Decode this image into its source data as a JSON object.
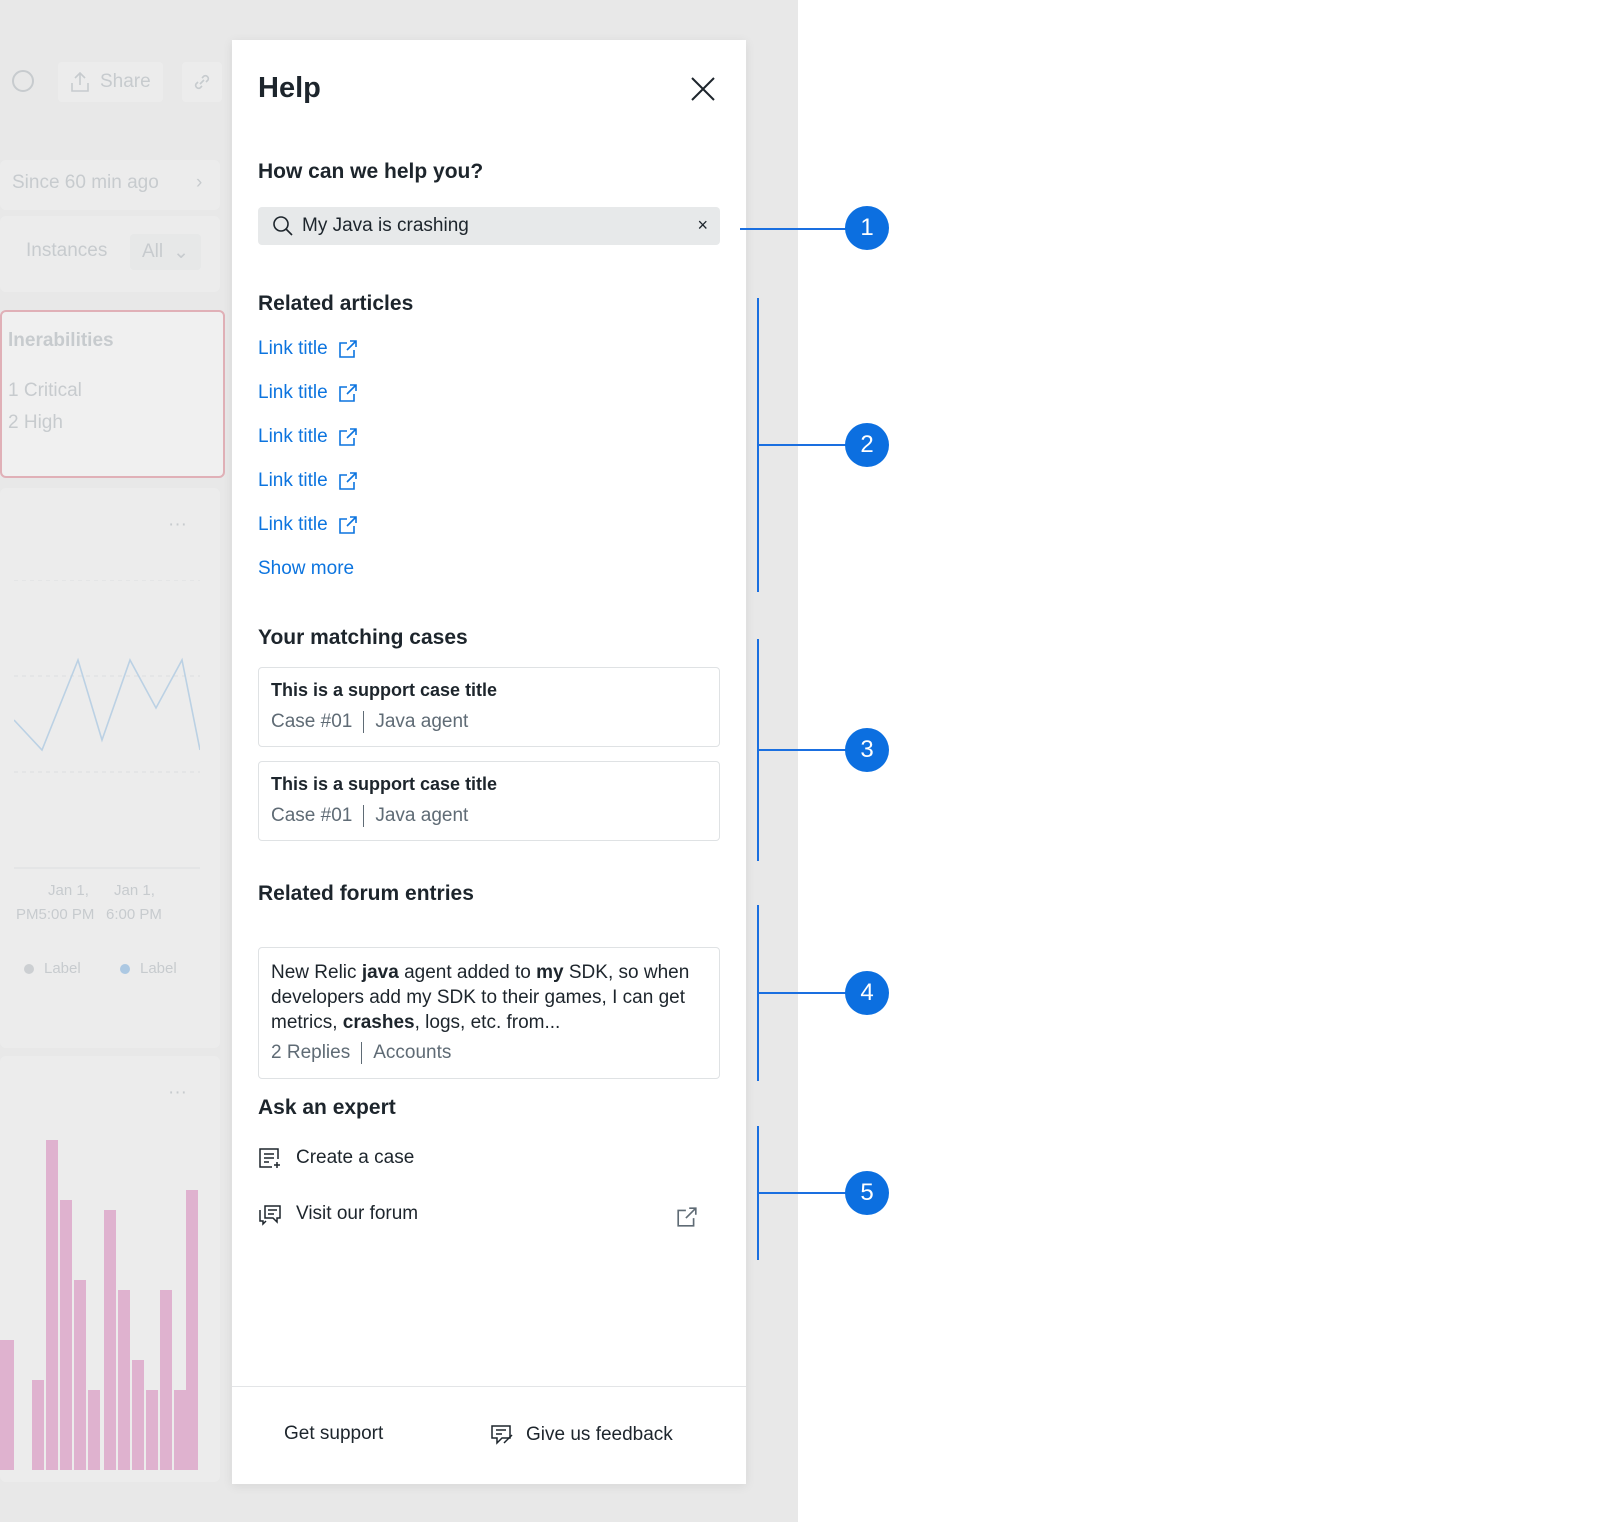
{
  "background": {
    "share_label": "Share",
    "time_label": "Since 60 min ago",
    "instances_label": "Instances",
    "instances_value": "All",
    "vuln_title": "lnerabilities",
    "critical_label": "1  Critical",
    "high_label": "2  High",
    "date1": "Jan 1,",
    "date2": "Jan 1,",
    "time1": "PM5:00 PM",
    "time2": "6:00 PM",
    "legend1": "Label",
    "legend2": "Label",
    "more_glyph": "···"
  },
  "panel": {
    "title": "Help",
    "search": {
      "heading": "How can we help you?",
      "value": "My Java is crashing",
      "clear_glyph": "×"
    },
    "articles": {
      "heading": "Related articles",
      "links": [
        "Link title",
        "Link title",
        "Link title",
        "Link title",
        "Link title"
      ],
      "show_more": "Show more"
    },
    "cases": {
      "heading": "Your matching cases",
      "items": [
        {
          "title": "This is a support case title",
          "number": "Case #01",
          "tag": "Java agent"
        },
        {
          "title": "This is a support case title",
          "number": "Case #01",
          "tag": "Java agent"
        }
      ]
    },
    "forum": {
      "heading": "Related forum entries",
      "entry": {
        "t1": "New Relic ",
        "b1": "java",
        "t2": " agent added to ",
        "b2": "my",
        "t3": " SDK, so when developers add my SDK to their games, I can get metrics, ",
        "b3": "crashes",
        "t4": ", logs, etc. from...",
        "replies": "2 Replies",
        "category": "Accounts"
      }
    },
    "expert": {
      "heading": "Ask an expert",
      "create_case": "Create a case",
      "visit_forum": "Visit our forum"
    },
    "footer": {
      "get_support": "Get support",
      "feedback": "Give us feedback"
    }
  },
  "annotations": [
    "1",
    "2",
    "3",
    "4",
    "5"
  ],
  "colors": {
    "accent": "#0c6fe0",
    "link": "#0c74df"
  }
}
